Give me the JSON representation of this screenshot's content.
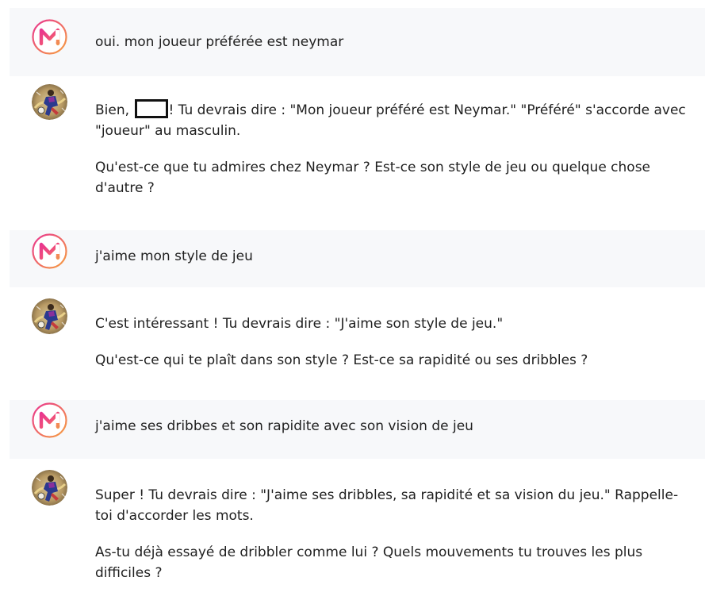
{
  "messages": [
    {
      "role": "user",
      "avatar_icon": "m-logo-icon",
      "paragraphs": [
        "oui. mon joueur préférée est neymar"
      ]
    },
    {
      "role": "assistant",
      "avatar_icon": "soccer-player-avatar-icon",
      "p1_before": "Bien, ",
      "p1_after": "! Tu devrais dire : \"Mon joueur préféré est Neymar.\" \"Préféré\" s'accorde avec \"joueur\" au masculin.",
      "paragraphs": [
        "Qu'est-ce que tu admires chez Neymar ? Est-ce son style de jeu ou quelque chose d'autre ?"
      ]
    },
    {
      "role": "user",
      "avatar_icon": "m-logo-icon",
      "paragraphs": [
        "j'aime mon style de jeu"
      ]
    },
    {
      "role": "assistant",
      "avatar_icon": "soccer-player-avatar-icon",
      "paragraphs": [
        "C'est intéressant ! Tu devrais dire : \"J'aime son style de jeu.\"",
        "Qu'est-ce qui te plaît dans son style ? Est-ce sa rapidité ou ses dribbles ?"
      ]
    },
    {
      "role": "user",
      "avatar_icon": "m-logo-icon",
      "paragraphs": [
        "j'aime ses dribbes et son rapidite avec son vision de jeu"
      ]
    },
    {
      "role": "assistant",
      "avatar_icon": "soccer-player-avatar-icon",
      "paragraphs": [
        "Super ! Tu devrais dire : \"J'aime ses dribbles, sa rapidité et sa vision du jeu.\" Rappelle-toi d'accorder les mots.",
        "As-tu déjà essayé de dribbler comme lui ? Quels mouvements tu trouves les plus difficiles ?"
      ]
    }
  ],
  "colors": {
    "user_bg": "#f7f8fa",
    "logo_gradient_start": "#f43f5e",
    "logo_gradient_end": "#f59e0b"
  }
}
